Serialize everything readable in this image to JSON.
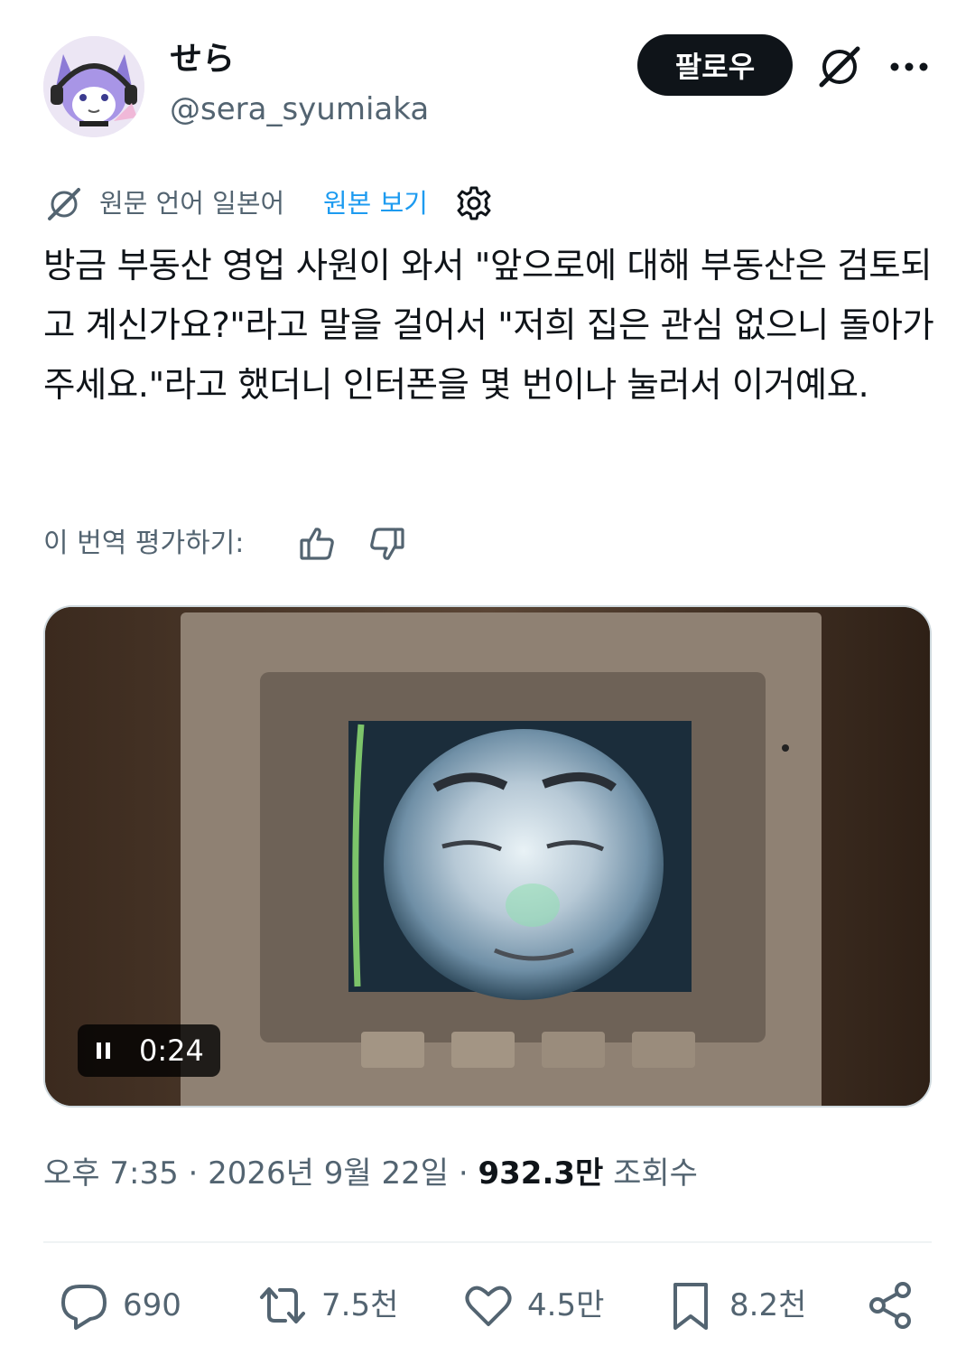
{
  "author": {
    "display_name": "せら",
    "handle": "@sera_syumiaka"
  },
  "header": {
    "follow_label": "팔로우",
    "grok_icon": "grok-icon",
    "more_icon": "more-icon"
  },
  "translation": {
    "label": "원문 언어 일본어",
    "show_original": "원본 보기",
    "rate_label": "이 번역 평가하기:"
  },
  "tweet": {
    "text": "방금 부동산 영업 사원이 와서 \"앞으로에 대해 부동산은 검토되고 계신가요?\"라고 말을 걸어서 \"저희 집은 관심 없으니 돌아가 주세요.\"라고 했더니 인터폰을 몇 번이나 눌러서 이거예요."
  },
  "video": {
    "time": "0:24",
    "state_icon": "pause-icon"
  },
  "meta": {
    "time": "오후 7:35",
    "separator": "·",
    "date": "2026년 9월 22일",
    "views": "932.3만",
    "views_label": "조회수"
  },
  "actions": {
    "replies": "690",
    "reposts": "7.5천",
    "likes": "4.5만",
    "bookmarks": "8.2천"
  },
  "colors": {
    "text": "#0f1419",
    "secondary": "#536471",
    "link": "#1d9bf0",
    "divider": "#eff3f4"
  }
}
